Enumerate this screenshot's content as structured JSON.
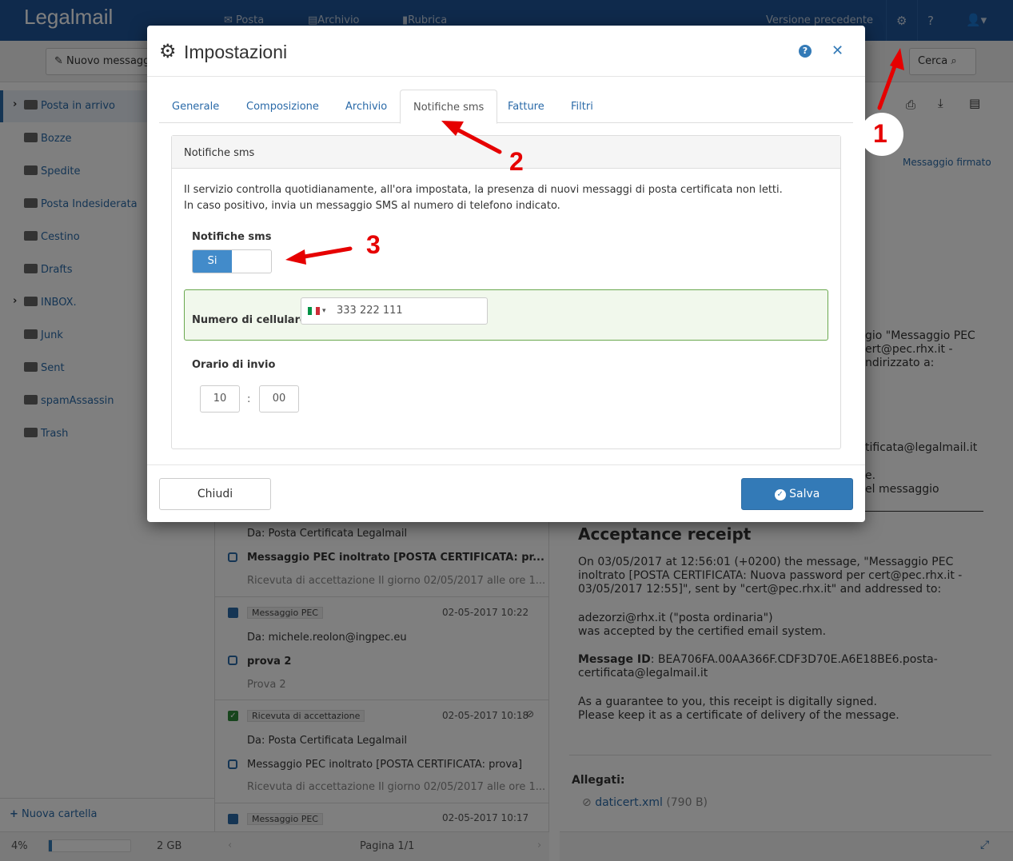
{
  "app": {
    "logo": "Legalmail"
  },
  "nav": {
    "tabs": [
      "Posta",
      "Archivio",
      "Rubrica"
    ],
    "prev_version": "Versione precedente"
  },
  "toolbar": {
    "new_message": "Nuovo messaggio",
    "search": "Cerca"
  },
  "sidebar": {
    "folders": [
      {
        "label": "Posta in arrivo",
        "selected": true,
        "expand": true
      },
      {
        "label": "Bozze"
      },
      {
        "label": "Spedite"
      },
      {
        "label": "Posta Indesiderata"
      },
      {
        "label": "Cestino"
      },
      {
        "label": "Drafts"
      },
      {
        "label": "INBOX.",
        "expand": true
      },
      {
        "label": "Junk"
      },
      {
        "label": "Sent"
      },
      {
        "label": "spamAssassin"
      },
      {
        "label": "Trash"
      }
    ],
    "new_folder": "Nuova cartella",
    "quota_percent": "4%",
    "quota_total": "2 GB",
    "quota_fill": 0.04
  },
  "messages": [
    {
      "from": "Da: Posta Certificata Legalmail",
      "subject": "Messaggio PEC inoltrato [POSTA CERTIFICATA: pr...",
      "preview": "Ricevuta di accettazione Il giorno 02/05/2017 alle ore 1...",
      "bold": true
    },
    {
      "tag": "Messaggio PEC",
      "date": "02-05-2017 10:22",
      "from": "Da: michele.reolon@ingpec.eu",
      "subject": "prova 2",
      "preview": "Prova 2",
      "bold": true
    },
    {
      "tag": "Ricevuta di accettazione",
      "date": "02-05-2017 10:18",
      "from": "Da: Posta Certificata Legalmail",
      "subject": "Messaggio PEC inoltrato [POSTA CERTIFICATA: prova]",
      "preview": "Ricevuta di accettazione Il giorno 02/05/2017 alle ore 1...",
      "bold": false
    },
    {
      "tag": "Messaggio PEC",
      "date": "02-05-2017 10:17"
    }
  ],
  "pagination": {
    "label": "Pagina 1/1"
  },
  "reader": {
    "signed": "Messaggio firmato",
    "partial1": "gio \"Messaggio PEC",
    "partial2": "ert@pec.rhx.it -",
    "partial3": "ndirizzato a:",
    "partial4": "tificata@legalmail.it",
    "partial5": "e.",
    "partial6": "el messaggio",
    "heading": "Acceptance receipt",
    "para1": "On 03/05/2017 at 12:56:01 (+0200) the message, \"Messaggio PEC inoltrato [POSTA CERTIFICATA: Nuova password per cert@pec.rhx.it - 03/05/2017 12:55]\", sent by \"cert@pec.rhx.it\" and addressed to:",
    "para2a": "adezorzi@rhx.it (\"posta ordinaria\")",
    "para2b": "was accepted by the certified email system.",
    "msgid_label": "Message ID",
    "msgid": ": BEA706FA.00AA366F.CDF3D70E.A6E18BE6.posta-certificata@legalmail.it",
    "para4a": "As a guarantee to you, this receipt is digitally signed.",
    "para4b": "Please keep it as a certificate of delivery of the message.",
    "attachments_label": "Allegati:",
    "attachment_name": "daticert.xml",
    "attachment_size": "(790 B)"
  },
  "modal": {
    "title": "Impostazioni",
    "tabs": [
      "Generale",
      "Composizione",
      "Archivio",
      "Notifiche sms",
      "Fatture",
      "Filtri"
    ],
    "active_tab": "Notifiche sms",
    "panel_title": "Notifiche sms",
    "desc1": "Il servizio controlla quotidianamente, all'ora impostata, la presenza di nuovi messaggi di posta certificata non letti.",
    "desc2": "In caso positivo, invia un messaggio SMS al numero di telefono indicato.",
    "toggle_label": "Notifiche sms",
    "toggle_on": "Si",
    "phone_label": "Numero di cellulare",
    "phone_value": "333 222 111",
    "time_label": "Orario di invio",
    "hour": "10",
    "sep": ":",
    "minute": "00",
    "close": "Chiudi",
    "save": "Salva"
  },
  "annotations": {
    "a1": "1",
    "a2": "2",
    "a3": "3"
  },
  "colors": {
    "brand": "#1f5598",
    "accent": "#337ab7",
    "annotation": "#e60000",
    "phone_bg": "#f1f8ec"
  }
}
